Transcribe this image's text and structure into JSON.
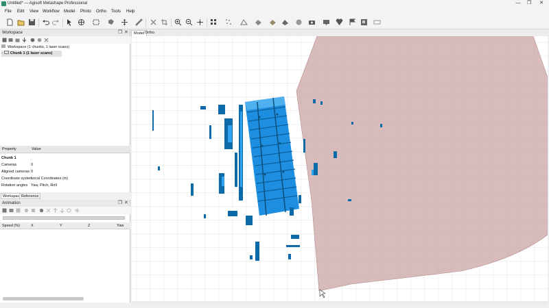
{
  "window": {
    "title": "Untitled* — Agisoft Metashape Professional",
    "minimize": "—",
    "maximize": "❐",
    "close": "✕"
  },
  "menu": [
    "File",
    "Edit",
    "View",
    "Workflow",
    "Model",
    "Photo",
    "Ortho",
    "Tools",
    "Help"
  ],
  "toolbar_icons": [
    "new-icon",
    "open-icon",
    "save-icon",
    "undo-icon",
    "redo-icon",
    "select-icon",
    "navigate-icon",
    "rectangle-select-icon",
    "lasso-select-icon",
    "move-object-icon",
    "ruler-icon",
    "delete-selection-icon",
    "crop-icon",
    "zoom-in-icon",
    "zoom-out-icon",
    "move-region-icon",
    "dense-cloud-icon",
    "points-icon",
    "mesh-icon",
    "shaded-icon",
    "textured-icon",
    "tiled-model-icon",
    "dem-icon",
    "camera-icon",
    "show-cameras-icon",
    "markers-icon",
    "flags-icon",
    "image-icon",
    "region-icon"
  ],
  "workspace": {
    "header": "Workspace",
    "tree": [
      {
        "label": "Workspace (1 chunks, 1 laser scans)",
        "bold": false
      },
      {
        "label": "Chunk 1 (1 laser scans)",
        "bold": true
      }
    ]
  },
  "properties": {
    "col_property": "Property",
    "col_value": "Value",
    "section": "Chunk 1",
    "rows": [
      {
        "property": "Cameras",
        "value": "0"
      },
      {
        "property": "Aligned cameras",
        "value": "0"
      },
      {
        "property": "Coordinate system",
        "value": "Local Coordinates (m)"
      },
      {
        "property": "Rotation angles",
        "value": "Yaw, Pitch, Roll"
      }
    ]
  },
  "bottom_tabs": [
    "Workspace",
    "Reference"
  ],
  "animation": {
    "header": "Animation",
    "columns": [
      "Speed (%)",
      "X",
      "Y",
      "Z",
      "Yaw"
    ]
  },
  "view_tabs": [
    "Model",
    "Ortho"
  ],
  "colors": {
    "accent_blue": "#1e8fe0",
    "point_dark": "#0b4f7a",
    "region_fill": "#c9a2a2",
    "grid": "#dcdcdc"
  }
}
